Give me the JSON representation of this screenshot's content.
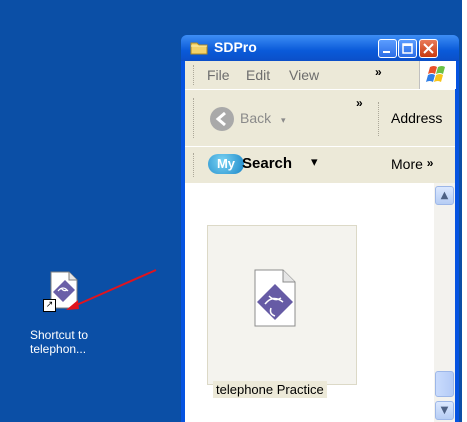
{
  "desktop": {
    "background": "#0b4fa6",
    "shortcut": {
      "label_line1": "Shortcut to",
      "label_line2": "telephon...",
      "overlay_icon": "shortcut-arrow-icon"
    }
  },
  "window": {
    "title": "SDPro",
    "titlebar_color": "#0a5ad9",
    "menu": [
      "File",
      "Edit",
      "View"
    ],
    "menu_more": "»",
    "toolbar": {
      "back_label": "Back",
      "back_caret": "▾",
      "more": "»",
      "address_label": "Address"
    },
    "search_bar": {
      "logo": "My",
      "label": "Search",
      "caret": "▾",
      "more_label": "More",
      "more_chevron": "»"
    },
    "content": {
      "file": {
        "name": "telephone Practice",
        "icon": "telephone-practice-file-icon"
      }
    }
  },
  "annotation": {
    "arrow_color": "#e0141e"
  }
}
